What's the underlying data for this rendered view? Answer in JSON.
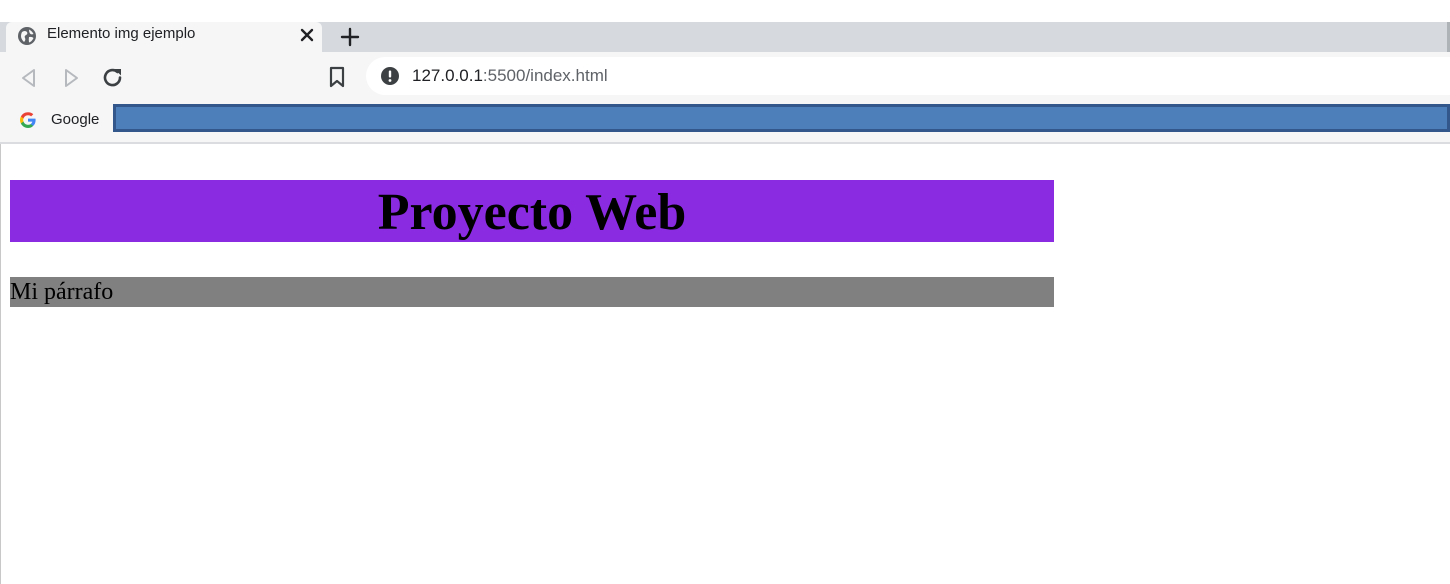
{
  "browser": {
    "tab": {
      "title": "Elemento img ejemplo",
      "favicon": "globe-icon"
    },
    "address_bar": {
      "host": "127.0.0.1",
      "path": ":5500/index.html",
      "icon": "info-icon"
    },
    "bookmarks_bar": {
      "items": [
        {
          "label": "Google",
          "icon": "google-g-icon"
        }
      ]
    },
    "colors": {
      "tab_strip": "#d6dade",
      "toolbar": "#f6f6f7",
      "bookmark_highlight": "#4d80bb"
    }
  },
  "page": {
    "header": {
      "text": "Proyecto Web",
      "background": "#8a2be2"
    },
    "paragraph": {
      "text": "Mi párrafo",
      "background": "#808080"
    }
  }
}
